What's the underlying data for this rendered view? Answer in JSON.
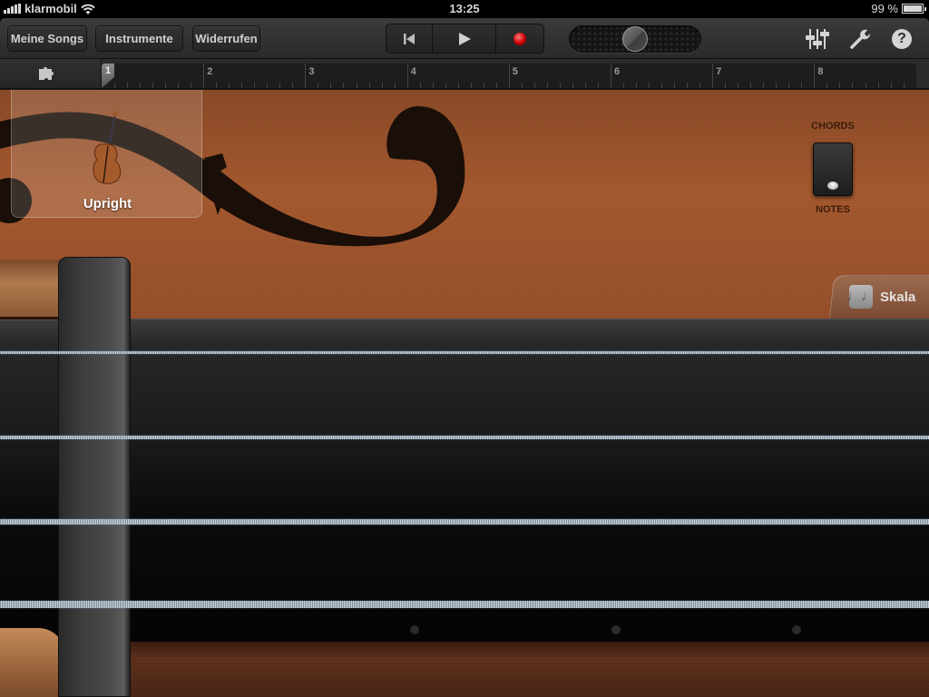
{
  "status_bar": {
    "carrier": "klarmobil",
    "time": "13:25",
    "battery": "99 %",
    "battery_level": 0.99,
    "icons": [
      "signal-icon",
      "wifi-icon",
      "battery-icon"
    ]
  },
  "toolbar": {
    "my_songs": "Meine Songs",
    "instruments": "Instrumente",
    "undo": "Widerrufen",
    "transport": {
      "rewind_icon": "skip-to-start-icon",
      "play_icon": "play-icon",
      "record_icon": "record-icon",
      "rewind_glyph": "⏮",
      "play_glyph": "▶"
    },
    "volume_level": 0.5,
    "right_icons": [
      "mixer-icon",
      "wrench-icon",
      "help-icon"
    ],
    "help_glyph": "?"
  },
  "ruler": {
    "bars": [
      "1",
      "2",
      "3",
      "4",
      "5",
      "6",
      "7",
      "8"
    ],
    "playhead_bar": "1",
    "tracks_icon": "puzzle-icon"
  },
  "instrument": {
    "name": "Upright",
    "icon": "upright-bass-icon"
  },
  "mode_switch": {
    "top_label": "CHORDS",
    "bottom_label": "NOTES",
    "selected": "NOTES"
  },
  "scale_tab": {
    "label": "Skala",
    "icon": "music-notes-icon",
    "glyph": "♩♩"
  },
  "fretboard": {
    "string_count": 4,
    "fret_markers": 3
  }
}
